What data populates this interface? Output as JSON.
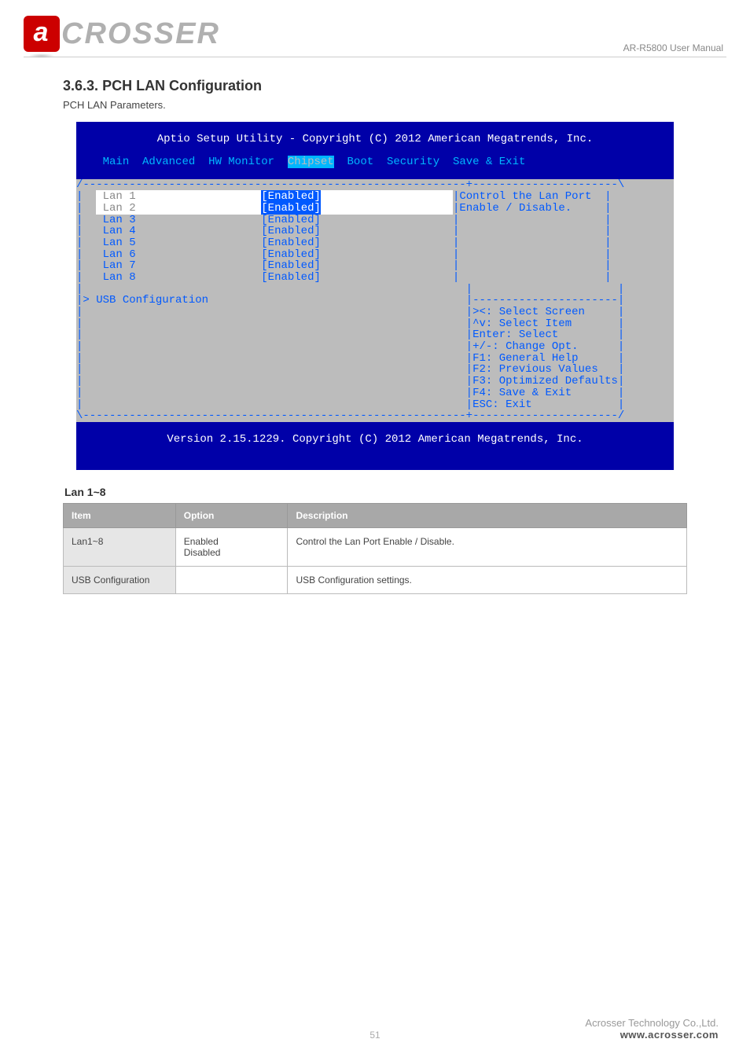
{
  "logo_text": "CROSSER",
  "doc_title": "AR-R5800 User Manual",
  "section_num": "3.6.3.",
  "section_title": "PCH LAN Configuration",
  "section_sub": "PCH LAN Parameters.",
  "bios": {
    "title1": "Aptio Setup Utility - Copyright (C) 2012 American Megatrends, Inc.",
    "tabs": [
      "Main",
      "Advanced",
      "HW Monitor",
      "Chipset",
      "Boot",
      "Security",
      "Save & Exit"
    ],
    "active_tab": "Chipset",
    "lan_items": [
      {
        "label": "Lan 1",
        "value": "[Enabled]"
      },
      {
        "label": "Lan 2",
        "value": "[Enabled]"
      },
      {
        "label": "Lan 3",
        "value": "[Enabled]"
      },
      {
        "label": "Lan 4",
        "value": "[Enabled]"
      },
      {
        "label": "Lan 5",
        "value": "[Enabled]"
      },
      {
        "label": "Lan 6",
        "value": "[Enabled]"
      },
      {
        "label": "Lan 7",
        "value": "[Enabled]"
      },
      {
        "label": "Lan 8",
        "value": "[Enabled]"
      }
    ],
    "submenu": "USB Configuration",
    "help1": "Control the Lan Port",
    "help2": "Enable / Disable.",
    "keys": [
      "><: Select Screen",
      "^v: Select Item",
      "Enter: Select",
      "+/-: Change Opt.",
      "F1: General Help",
      "F2: Previous Values",
      "F3: Optimized Defaults",
      "F4: Save & Exit",
      "ESC: Exit"
    ],
    "footer": "Version 2.15.1229. Copyright (C) 2012 American Megatrends, Inc."
  },
  "table": {
    "subhead": "Lan 1~8",
    "headers": [
      "Item",
      "Option",
      "Description"
    ],
    "rows": [
      {
        "item": "Lan1~8",
        "option": "Enabled\nDisabled",
        "desc": "Control the Lan Port Enable / Disable."
      },
      {
        "item": "USB Configuration",
        "option": "",
        "desc": "USB Configuration settings."
      }
    ]
  },
  "footer": {
    "company": "Acrosser Technology Co.,Ltd.",
    "url": "www.acrosser.com"
  },
  "page_num": "51"
}
